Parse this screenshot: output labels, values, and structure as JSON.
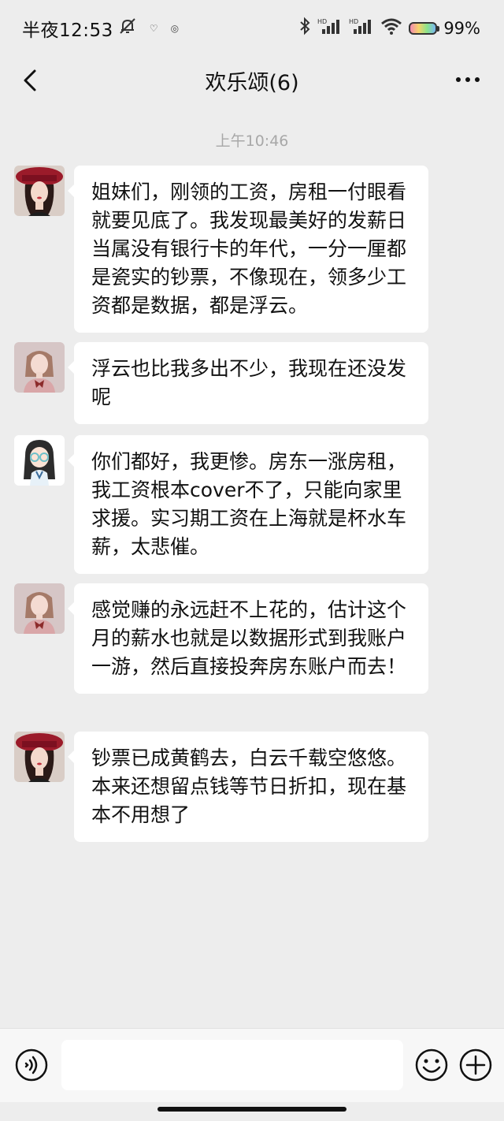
{
  "status_bar": {
    "time": "半夜12:53",
    "battery_text": "99%"
  },
  "header": {
    "title": "欢乐颂(6)"
  },
  "chat": {
    "timestamp": "上午10:46",
    "messages": [
      {
        "avatar": "avatar-woman-red-hat",
        "text": "姐妹们，刚领的工资，房租一付眼看就要见底了。我发现最美好的发薪日当属没有银行卡的年代，一分一厘都是瓷实的钞票，不像现在，领多少工资都是数据，都是浮云。"
      },
      {
        "avatar": "avatar-woman-pink-bow",
        "text": "浮云也比我多出不少，我现在还没发呢"
      },
      {
        "avatar": "avatar-cartoon-girl-glasses",
        "text": "你们都好，我更惨。房东一涨房租，我工资根本cover不了，只能向家里求援。实习期工资在上海就是杯水车薪，太悲催。"
      },
      {
        "avatar": "avatar-woman-pink-bow",
        "text": "感觉赚的永远赶不上花的，估计这个月的薪水也就是以数据形式到我账户一游，然后直接投奔房东账户而去！"
      },
      {
        "avatar": "avatar-woman-red-hat",
        "text": "钞票已成黄鹤去，白云千载空悠悠。本来还想留点钱等节日折扣，现在基本不用想了"
      }
    ]
  },
  "input_bar": {
    "value": ""
  }
}
